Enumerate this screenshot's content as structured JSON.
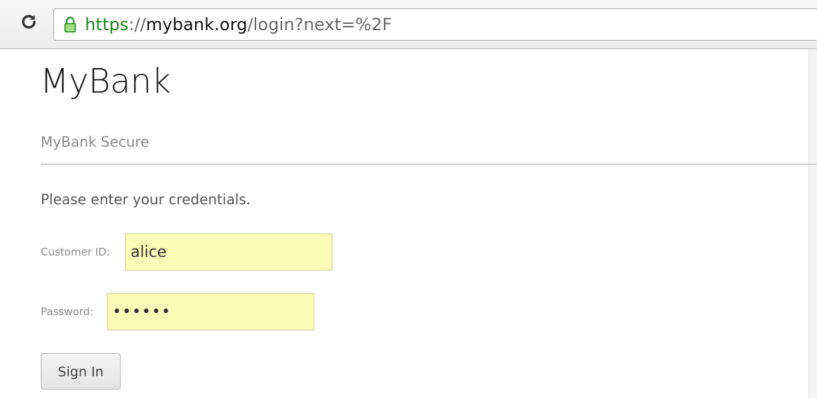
{
  "browser": {
    "url": {
      "scheme": "https",
      "separator": "://",
      "host": "mybank.org",
      "path": "/login?next=%2F"
    },
    "icons": {
      "reload": "reload-icon",
      "lock": "lock-icon"
    },
    "colors": {
      "secure_scheme": "#1a8a1a"
    }
  },
  "page": {
    "site_title": "MyBank",
    "site_subtitle": "MyBank Secure",
    "instructions": "Please enter your credentials.",
    "form": {
      "customer_id_label": "Customer ID:",
      "customer_id_value": "alice",
      "password_label": "Password:",
      "password_value": "aaaaaa",
      "submit_label": "Sign In"
    },
    "colors": {
      "autofill_background": "#fbfcb8"
    }
  }
}
